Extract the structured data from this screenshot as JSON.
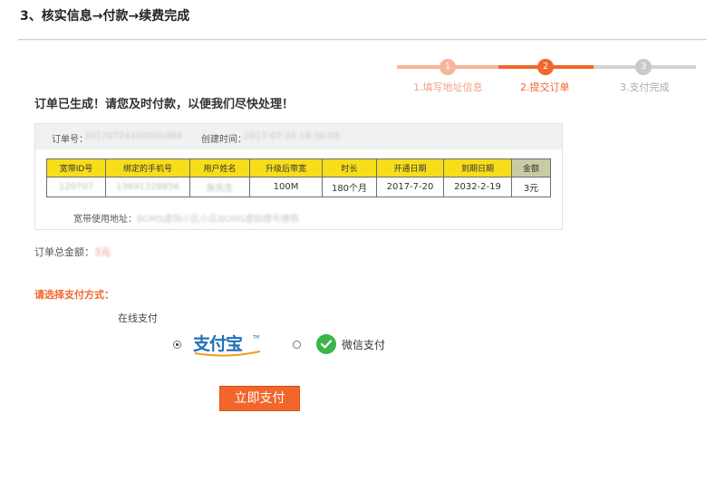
{
  "heading": "3、核实信息→付款→续费完成",
  "steps": [
    {
      "num": "1",
      "label": "1.填写地址信息"
    },
    {
      "num": "2",
      "label": "2.提交订单"
    },
    {
      "num": "3",
      "label": "3.支付完成"
    }
  ],
  "order_notice": "订单已生成！请您及时付款，以便我们尽快处理！",
  "order": {
    "number_label": "订单号：",
    "number_value": "20170724100001084",
    "created_label": "创建时间：",
    "created_value": "2017-07-24 16:30:05",
    "table": {
      "headers": [
        "宽带ID号",
        "绑定的手机号",
        "用户姓名",
        "升级后带宽",
        "时长",
        "开通日期",
        "到期日期",
        "金额"
      ],
      "row": [
        "120707",
        "13691328856",
        "张先生",
        "100M",
        "180个月",
        "2017-7-20",
        "2032-2-19",
        "3元"
      ]
    },
    "address_label": "宽带使用地址：",
    "address_value": "BOMS虚拟小区小区BOMS虚拟楼号楼栋"
  },
  "total": {
    "label": "订单总金额：",
    "value": "3元"
  },
  "payment": {
    "title": "请选择支付方式：",
    "online_label": "在线支付",
    "alipay_logo_text": "支付宝",
    "wechat_label": "微信支付",
    "selected": "alipay"
  },
  "pay_button": "立即支付",
  "colors": {
    "accent": "#f2662b",
    "table_header": "#f7dd1a",
    "wechat": "#3bb54a",
    "alipay": "#1d6fb8"
  }
}
